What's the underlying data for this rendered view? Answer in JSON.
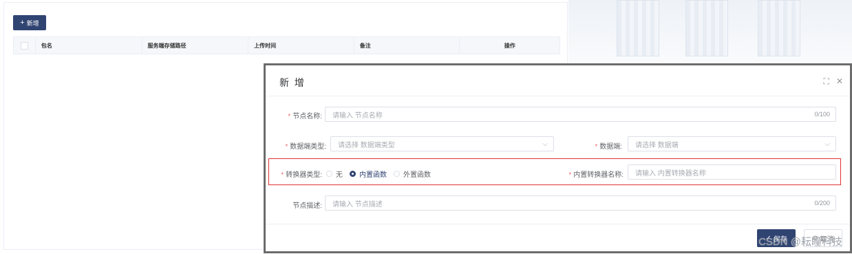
{
  "toolbar": {
    "add_label": "新增",
    "add_icon": "plus-icon"
  },
  "table": {
    "columns": [
      "包名",
      "服务端存储路径",
      "上传时间",
      "备注",
      "操作"
    ]
  },
  "dialog": {
    "title": "新 增",
    "fields": {
      "node_name": {
        "label": "节点名称:",
        "placeholder": "请输入 节点名称",
        "count": "0/100"
      },
      "data_end_type": {
        "label": "数据端类型:",
        "placeholder": "请选择 数据端类型"
      },
      "data_end": {
        "label": "数据端:",
        "placeholder": "请选择 数据端"
      },
      "converter_type": {
        "label": "转换器类型:",
        "options": [
          "无",
          "内置函数",
          "外置函数"
        ],
        "selected": "内置函数"
      },
      "builtin_converter_name": {
        "label": "内置转换器名称:",
        "placeholder": "请输入 内置转换器名称"
      },
      "node_desc": {
        "label": "节点描述:",
        "placeholder": "请输入 节点描述",
        "count": "0/200"
      }
    },
    "required_star": "*",
    "buttons": {
      "save": "保存",
      "cancel": "取消"
    }
  },
  "watermark": "CSDN @耘瞳科技",
  "colors": {
    "primary": "#304472",
    "required": "#f56c6c",
    "highlight_border": "#e03131"
  }
}
